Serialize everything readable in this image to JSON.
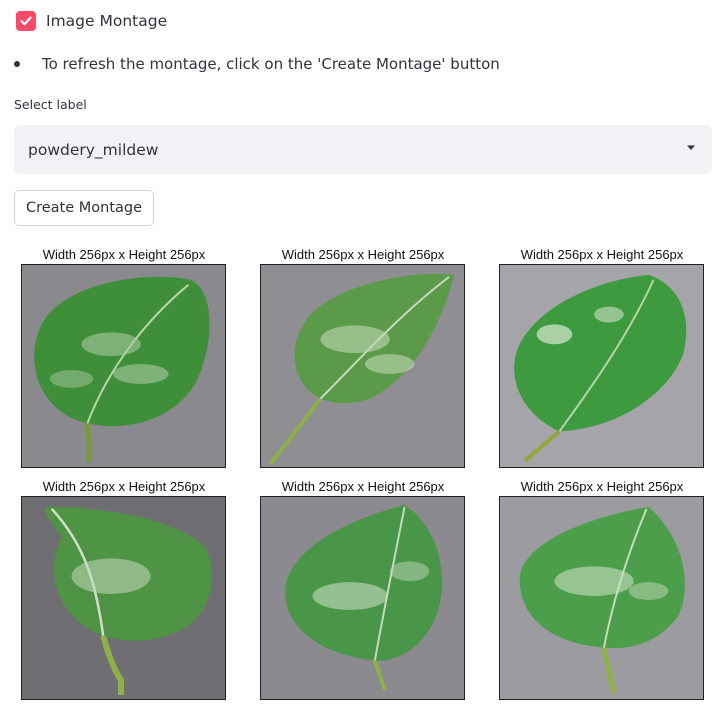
{
  "checkbox": {
    "label": "Image Montage",
    "checked": true
  },
  "info": {
    "text": "To refresh the montage, click on the 'Create Montage' button"
  },
  "select": {
    "label": "Select label",
    "value": "powdery_mildew"
  },
  "create_button": {
    "label": "Create Montage"
  },
  "montage": {
    "tiles": [
      {
        "caption": "Width 256px x Height 256px"
      },
      {
        "caption": "Width 256px x Height 256px"
      },
      {
        "caption": "Width 256px x Height 256px"
      },
      {
        "caption": "Width 256px x Height 256px"
      },
      {
        "caption": "Width 256px x Height 256px"
      },
      {
        "caption": "Width 256px x Height 256px"
      }
    ]
  },
  "colors": {
    "accent": "#ff4b6b",
    "select_bg": "#f0f2f6",
    "text": "#31333f"
  }
}
